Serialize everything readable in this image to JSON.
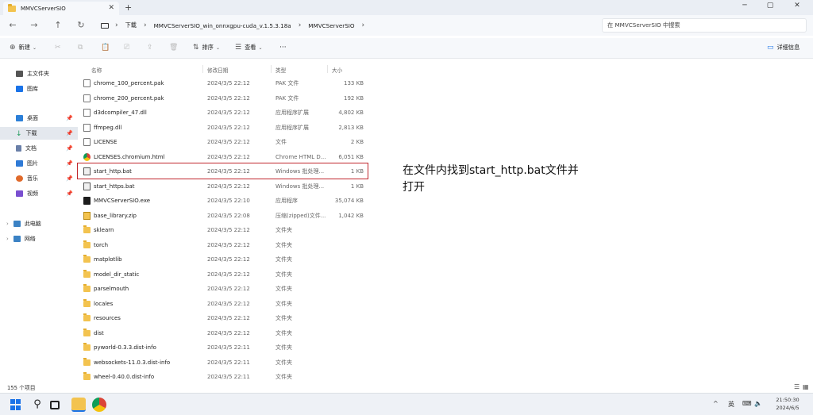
{
  "window": {
    "tab_title": "MMVCServerSIO",
    "new_tab": "+",
    "close_tab": "✕",
    "minimize": "─",
    "maximize": "▢",
    "close": "✕"
  },
  "nav": {
    "back": "←",
    "forward": "→",
    "up": "↑",
    "refresh": "↻",
    "breadcrumbs": [
      "下载",
      "MMVCServerSIO_win_onnxgpu-cuda_v.1.5.3.18a",
      "MMVCServerSIO"
    ],
    "search_placeholder": "在 MMVCServerSIO 中搜索"
  },
  "toolbar": {
    "new_label": "新建",
    "sort_label": "排序",
    "view_label": "查看",
    "more_label": "···",
    "details_label": "详细信息"
  },
  "sidebar": {
    "items": [
      {
        "label": "主文件夹",
        "icon": "home-icon",
        "color": "#555555"
      },
      {
        "label": "图库",
        "icon": "gallery-icon",
        "color": "#1a73e8"
      },
      {
        "label": "桌面",
        "icon": "desktop-icon",
        "color": "#2b7fd8",
        "pinned": true
      },
      {
        "label": "下载",
        "icon": "download-icon",
        "color": "#1e9b5a",
        "pinned": true,
        "selected": true
      },
      {
        "label": "文档",
        "icon": "document-icon",
        "color": "#6a7fa8",
        "pinned": true
      },
      {
        "label": "图片",
        "icon": "pictures-icon",
        "color": "#2f7ad6",
        "pinned": true
      },
      {
        "label": "音乐",
        "icon": "music-icon",
        "color": "#e06a2b",
        "pinned": true
      },
      {
        "label": "视频",
        "icon": "video-icon",
        "color": "#7a4fd0",
        "pinned": true
      },
      {
        "label": "此电脑",
        "icon": "this-pc-icon",
        "color": "#3b82c4"
      },
      {
        "label": "网络",
        "icon": "network-icon",
        "color": "#3b82c4"
      }
    ]
  },
  "columns": {
    "name": "名称",
    "date": "修改日期",
    "type": "类型",
    "size": "大小"
  },
  "files": [
    {
      "name": "chrome_100_percent.pak",
      "date": "2024/3/5 22:12",
      "type": "PAK 文件",
      "size": "133 KB",
      "icon": "file"
    },
    {
      "name": "chrome_200_percent.pak",
      "date": "2024/3/5 22:12",
      "type": "PAK 文件",
      "size": "192 KB",
      "icon": "file"
    },
    {
      "name": "d3dcompiler_47.dll",
      "date": "2024/3/5 22:12",
      "type": "应用程序扩展",
      "size": "4,802 KB",
      "icon": "gear"
    },
    {
      "name": "ffmpeg.dll",
      "date": "2024/3/5 22:12",
      "type": "应用程序扩展",
      "size": "2,813 KB",
      "icon": "gear"
    },
    {
      "name": "LICENSE",
      "date": "2024/3/5 22:12",
      "type": "文件",
      "size": "2 KB",
      "icon": "file"
    },
    {
      "name": "LICENSES.chromium.html",
      "date": "2024/3/5 22:12",
      "type": "Chrome HTML D...",
      "size": "6,051 KB",
      "icon": "chrome"
    },
    {
      "name": "start_http.bat",
      "date": "2024/3/5 22:12",
      "type": "Windows 批处理...",
      "size": "1 KB",
      "icon": "bat"
    },
    {
      "name": "start_https.bat",
      "date": "2024/3/5 22:12",
      "type": "Windows 批处理...",
      "size": "1 KB",
      "icon": "bat"
    },
    {
      "name": "MMVCServerSIO.exe",
      "date": "2024/3/5 22:10",
      "type": "应用程序",
      "size": "35,074 KB",
      "icon": "exe"
    },
    {
      "name": "base_library.zip",
      "date": "2024/3/5 22:08",
      "type": "压缩(zipped)文件...",
      "size": "1,042 KB",
      "icon": "zip"
    },
    {
      "name": "sklearn",
      "date": "2024/3/5 22:12",
      "type": "文件夹",
      "size": "",
      "icon": "folder"
    },
    {
      "name": "torch",
      "date": "2024/3/5 22:12",
      "type": "文件夹",
      "size": "",
      "icon": "folder"
    },
    {
      "name": "matplotlib",
      "date": "2024/3/5 22:12",
      "type": "文件夹",
      "size": "",
      "icon": "folder"
    },
    {
      "name": "model_dir_static",
      "date": "2024/3/5 22:12",
      "type": "文件夹",
      "size": "",
      "icon": "folder"
    },
    {
      "name": "parselmouth",
      "date": "2024/3/5 22:12",
      "type": "文件夹",
      "size": "",
      "icon": "folder"
    },
    {
      "name": "locales",
      "date": "2024/3/5 22:12",
      "type": "文件夹",
      "size": "",
      "icon": "folder"
    },
    {
      "name": "resources",
      "date": "2024/3/5 22:12",
      "type": "文件夹",
      "size": "",
      "icon": "folder"
    },
    {
      "name": "dist",
      "date": "2024/3/5 22:12",
      "type": "文件夹",
      "size": "",
      "icon": "folder"
    },
    {
      "name": "pyworld-0.3.3.dist-info",
      "date": "2024/3/5 22:11",
      "type": "文件夹",
      "size": "",
      "icon": "folder"
    },
    {
      "name": "websockets-11.0.3.dist-info",
      "date": "2024/3/5 22:11",
      "type": "文件夹",
      "size": "",
      "icon": "folder"
    },
    {
      "name": "wheel-0.40.0.dist-info",
      "date": "2024/3/5 22:11",
      "type": "文件夹",
      "size": "",
      "icon": "folder"
    }
  ],
  "annotation": {
    "text": "在文件内找到start_http.bat文件并打开",
    "color": "#c0262d"
  },
  "status": {
    "item_count": "155 个项目"
  },
  "taskbar": {
    "ime": "英",
    "time": "21:50:30",
    "date": "2024/6/5",
    "chevron": "^"
  }
}
